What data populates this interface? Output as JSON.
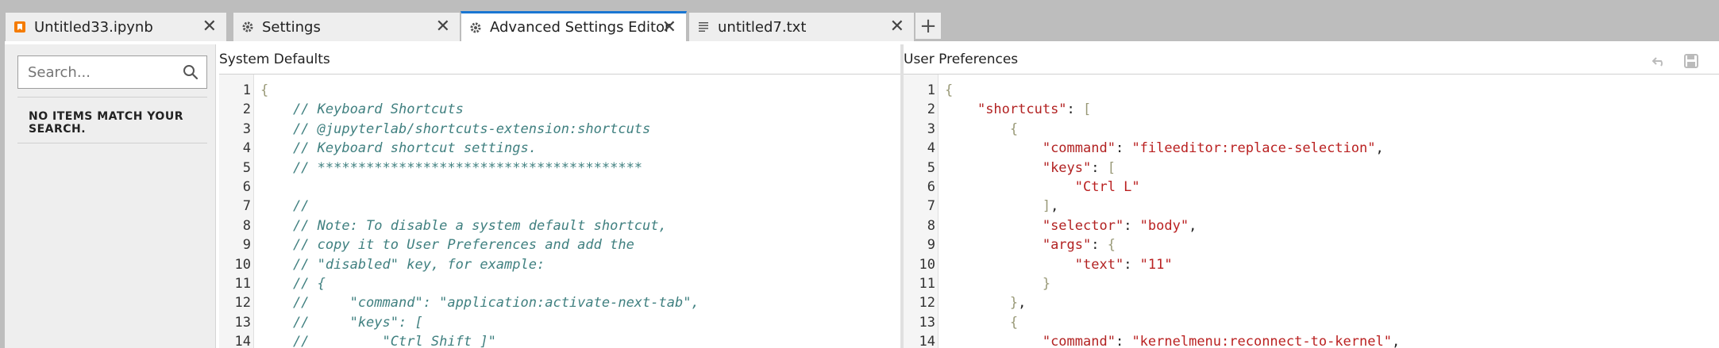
{
  "tabs": [
    {
      "label": "Untitled33.ipynb",
      "icon": "notebook-icon",
      "active": false
    },
    {
      "label": "Settings",
      "icon": "gear-icon",
      "active": false
    },
    {
      "label": "Advanced Settings Editor",
      "icon": "gear-icon",
      "active": true
    },
    {
      "label": "untitled7.txt",
      "icon": "text-file-icon",
      "active": false
    }
  ],
  "add_tab_label": "+",
  "close_glyph": "✕",
  "colors": {
    "accent": "#1976d2",
    "comment": "#408080",
    "string": "#ba2121",
    "notebook_icon": "#f57c00"
  },
  "search": {
    "placeholder": "Search..."
  },
  "empty_message": "NO ITEMS MATCH YOUR SEARCH.",
  "system_defaults": {
    "title": "System Defaults",
    "lines": [
      {
        "n": "1",
        "segments": [
          {
            "t": "{",
            "c": "c-brace"
          }
        ]
      },
      {
        "n": "2",
        "segments": [
          {
            "t": "    // Keyboard Shortcuts",
            "c": "c-cmt"
          }
        ]
      },
      {
        "n": "3",
        "segments": [
          {
            "t": "    // @jupyterlab/shortcuts-extension:shortcuts",
            "c": "c-cmt"
          }
        ]
      },
      {
        "n": "4",
        "segments": [
          {
            "t": "    // Keyboard shortcut settings.",
            "c": "c-cmt"
          }
        ]
      },
      {
        "n": "5",
        "segments": [
          {
            "t": "    // ****************************************",
            "c": "c-cmt"
          }
        ]
      },
      {
        "n": "6",
        "segments": []
      },
      {
        "n": "7",
        "segments": [
          {
            "t": "    //",
            "c": "c-cmt"
          }
        ]
      },
      {
        "n": "8",
        "segments": [
          {
            "t": "    // Note: To disable a system default shortcut,",
            "c": "c-cmt"
          }
        ]
      },
      {
        "n": "9",
        "segments": [
          {
            "t": "    // copy it to User Preferences and add the",
            "c": "c-cmt"
          }
        ]
      },
      {
        "n": "10",
        "segments": [
          {
            "t": "    // \"disabled\" key, for example:",
            "c": "c-cmt"
          }
        ]
      },
      {
        "n": "11",
        "segments": [
          {
            "t": "    // {",
            "c": "c-cmt"
          }
        ]
      },
      {
        "n": "12",
        "segments": [
          {
            "t": "    //     \"command\": \"application:activate-next-tab\",",
            "c": "c-cmt"
          }
        ]
      },
      {
        "n": "13",
        "segments": [
          {
            "t": "    //     \"keys\": [",
            "c": "c-cmt"
          }
        ]
      },
      {
        "n": "14",
        "segments": [
          {
            "t": "    //         \"Ctrl Shift ]\"",
            "c": "c-cmt"
          }
        ]
      }
    ]
  },
  "user_preferences": {
    "title": "User Preferences",
    "lines": [
      {
        "n": "1",
        "segments": [
          {
            "t": "{",
            "c": "c-brace"
          }
        ]
      },
      {
        "n": "2",
        "segments": [
          {
            "t": "    ",
            "c": "c-punct"
          },
          {
            "t": "\"shortcuts\"",
            "c": "c-key"
          },
          {
            "t": ": ",
            "c": "c-punct"
          },
          {
            "t": "[",
            "c": "c-brace"
          }
        ]
      },
      {
        "n": "3",
        "segments": [
          {
            "t": "        ",
            "c": "c-punct"
          },
          {
            "t": "{",
            "c": "c-brace"
          }
        ]
      },
      {
        "n": "4",
        "segments": [
          {
            "t": "            ",
            "c": "c-punct"
          },
          {
            "t": "\"command\"",
            "c": "c-key"
          },
          {
            "t": ": ",
            "c": "c-punct"
          },
          {
            "t": "\"fileeditor:replace-selection\"",
            "c": "c-str"
          },
          {
            "t": ",",
            "c": "c-punct"
          }
        ]
      },
      {
        "n": "5",
        "segments": [
          {
            "t": "            ",
            "c": "c-punct"
          },
          {
            "t": "\"keys\"",
            "c": "c-key"
          },
          {
            "t": ": ",
            "c": "c-punct"
          },
          {
            "t": "[",
            "c": "c-brace"
          }
        ]
      },
      {
        "n": "6",
        "segments": [
          {
            "t": "                ",
            "c": "c-punct"
          },
          {
            "t": "\"Ctrl L\"",
            "c": "c-str"
          }
        ]
      },
      {
        "n": "7",
        "segments": [
          {
            "t": "            ",
            "c": "c-punct"
          },
          {
            "t": "]",
            "c": "c-brace"
          },
          {
            "t": ",",
            "c": "c-punct"
          }
        ]
      },
      {
        "n": "8",
        "segments": [
          {
            "t": "            ",
            "c": "c-punct"
          },
          {
            "t": "\"selector\"",
            "c": "c-key"
          },
          {
            "t": ": ",
            "c": "c-punct"
          },
          {
            "t": "\"body\"",
            "c": "c-str"
          },
          {
            "t": ",",
            "c": "c-punct"
          }
        ]
      },
      {
        "n": "9",
        "segments": [
          {
            "t": "            ",
            "c": "c-punct"
          },
          {
            "t": "\"args\"",
            "c": "c-key"
          },
          {
            "t": ": ",
            "c": "c-punct"
          },
          {
            "t": "{",
            "c": "c-brace"
          }
        ]
      },
      {
        "n": "10",
        "segments": [
          {
            "t": "                ",
            "c": "c-punct"
          },
          {
            "t": "\"text\"",
            "c": "c-key"
          },
          {
            "t": ": ",
            "c": "c-punct"
          },
          {
            "t": "\"11\"",
            "c": "c-str"
          }
        ]
      },
      {
        "n": "11",
        "segments": [
          {
            "t": "            ",
            "c": "c-punct"
          },
          {
            "t": "}",
            "c": "c-brace"
          }
        ]
      },
      {
        "n": "12",
        "segments": [
          {
            "t": "        ",
            "c": "c-punct"
          },
          {
            "t": "}",
            "c": "c-brace"
          },
          {
            "t": ",",
            "c": "c-punct"
          }
        ]
      },
      {
        "n": "13",
        "segments": [
          {
            "t": "        ",
            "c": "c-punct"
          },
          {
            "t": "{",
            "c": "c-brace"
          }
        ]
      },
      {
        "n": "14",
        "segments": [
          {
            "t": "            ",
            "c": "c-punct"
          },
          {
            "t": "\"command\"",
            "c": "c-key"
          },
          {
            "t": ": ",
            "c": "c-punct"
          },
          {
            "t": "\"kernelmenu:reconnect-to-kernel\"",
            "c": "c-str"
          },
          {
            "t": ",",
            "c": "c-punct"
          }
        ]
      }
    ]
  },
  "toolbar": {
    "undo_icon": "undo-icon",
    "save_icon": "save-icon"
  }
}
